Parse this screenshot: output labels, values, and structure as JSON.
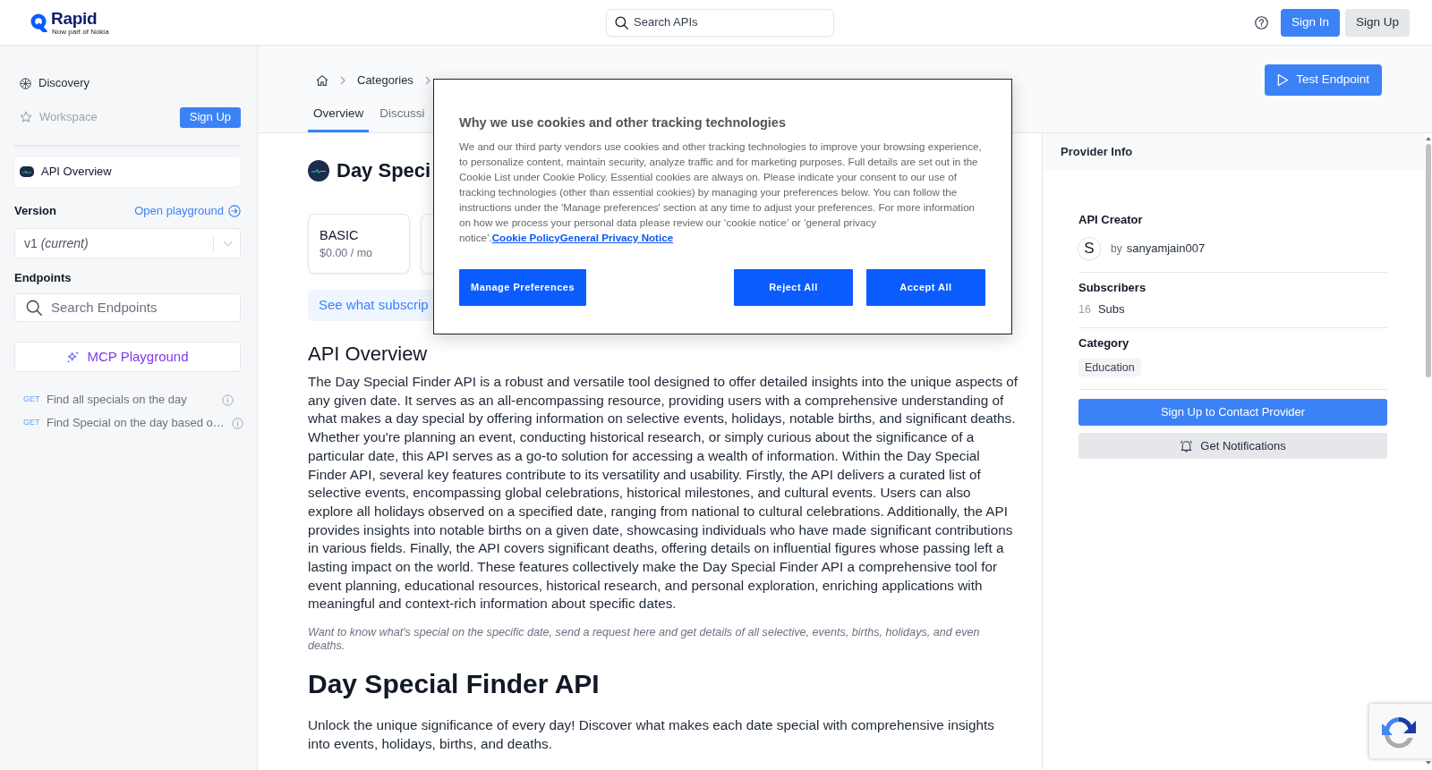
{
  "header": {
    "logo": {
      "wordmark": "Rapid",
      "tagline": "Now part of Nokia"
    },
    "search": {
      "placeholder": "Search APIs"
    },
    "buttons": [
      {
        "label": "Sign In",
        "kind": "primary"
      },
      {
        "label": "Sign Up",
        "kind": "secondary"
      }
    ]
  },
  "sidebar": {
    "nav": [
      {
        "label": "Discovery",
        "disabled": false
      },
      {
        "label": "Workspace",
        "disabled": true,
        "button": "Sign Up"
      }
    ],
    "overview_item": {
      "label": "API Overview",
      "selected": true
    },
    "version": {
      "label": "Version",
      "link": "Open playground",
      "value": "v1 *(current)*"
    },
    "endpoints": {
      "label": "Endpoints",
      "search": {
        "placeholder": "Search Endpoints"
      },
      "button": "MCP Playground",
      "items": [
        {
          "method": "GET",
          "name": "Find all specials on the day"
        },
        {
          "method": "GET",
          "name": "Find Special on the day based o…"
        }
      ]
    }
  },
  "main": {
    "breadcrumb": [
      "Categories"
    ],
    "tabs": [
      {
        "label": "Overview",
        "selected": true
      },
      {
        "label": "Discussi",
        "selected": false
      }
    ],
    "test_button": "Test Endpoint",
    "title": "Day Speci",
    "plans": [
      {
        "name": "BASIC",
        "price": "$0.00 / mo"
      }
    ],
    "banner": "See what subscrip",
    "overview": {
      "heading": "API Overview",
      "text": "The Day Special Finder API is a robust and versatile tool designed to offer detailed insights into the unique aspects of any given date. It serves as an all-encompassing resource, providing users with a comprehensive understanding of what makes a day special by offering information on selective events, holidays, notable births, and significant deaths. Whether you're planning an event, conducting historical research, or simply curious about the significance of a particular date, this API serves as a go-to solution for accessing a wealth of information. Within the Day Special Finder API, several key features contribute to its versatility and usability. Firstly, the API delivers a curated list of selective events, encompassing global celebrations, historical milestones, and cultural events. Users can also explore all holidays observed on a specified date, ranging from national to cultural celebrations. Additionally, the API provides insights into notable births on a given date, showcasing individuals who have made significant contributions in various fields. Finally, the API covers significant deaths, offering details on influential figures whose passing left a lasting impact on the world. These features collectively make the Day Special Finder API a comprehensive tool for event planning, educational resources, historical research, and personal exploration, enriching applications with meaningful and context-rich information about specific dates.",
      "note": "Want to know what's special on the specific date, send a request here and get details of all selective, events, births, holidays, and even deaths."
    },
    "readme": {
      "heading": "Day Special Finder API",
      "text": "Unlock the unique significance of every day! Discover what makes each date special with comprehensive insights into events, holidays, births, and deaths."
    }
  },
  "provider": {
    "title": "Provider Info",
    "creator": {
      "label": "API Creator",
      "initial": "S",
      "prefix": "by",
      "name": "sanyamjain007"
    },
    "subscribers": {
      "label": "Subscribers",
      "count": "16",
      "unit": "Subs"
    },
    "category": {
      "label": "Category",
      "tag": "Education"
    },
    "buttons": [
      {
        "label": "Sign Up to Contact Provider",
        "kind": "primary"
      },
      {
        "label": "Get Notifications",
        "kind": "secondary"
      }
    ]
  },
  "cookie_dialog": {
    "title": "Why we use cookies and other tracking technologies",
    "text": "We and our third party vendors use cookies and other tracking technologies to improve your browsing experience, to personalize content, maintain security, analyze traffic and for marketing purposes. Full details are set out in the Cookie List under Cookie Policy. Essential cookies are always on. Please indicate your consent to our use of tracking technologies (other than essential cookies) by managing your preferences below. You can follow the instructions under the 'Manage preferences' section at any time to adjust your preferences. For more information on how we process your personal data please review our ‘cookie notice’ or ‘general privacy notice’.",
    "links": [
      "Cookie Policy",
      "General Privacy Notice"
    ],
    "buttons": [
      "Manage Preferences",
      "Reject All",
      "Accept All"
    ]
  }
}
